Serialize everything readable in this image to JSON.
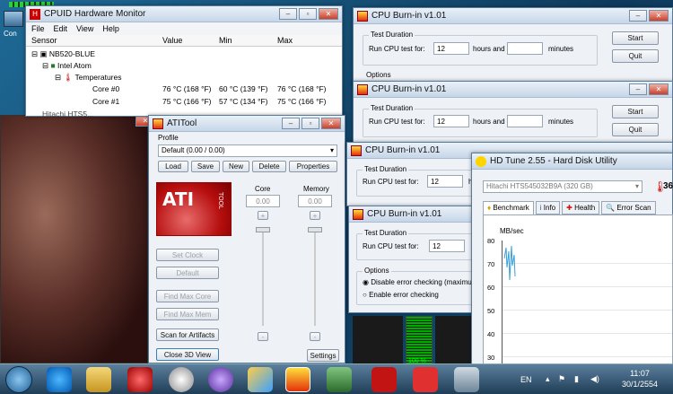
{
  "taskbar": {
    "lang": "EN",
    "time": "11:07",
    "date": "30/1/2554"
  },
  "desktop": {
    "icon_label": "Con"
  },
  "cpuid": {
    "title": "CPUID Hardware Monitor",
    "menu": [
      "File",
      "Edit",
      "View",
      "Help"
    ],
    "headers": [
      "Sensor",
      "Value",
      "Min",
      "Max"
    ],
    "tree": {
      "computer": "NB520-BLUE",
      "cpu": "Intel Atom",
      "group": "Temperatures",
      "partial": "Hitachi HTS5..."
    },
    "rows": [
      {
        "name": "Core #0",
        "value": "76 °C (168 °F)",
        "min": "60 °C (139 °F)",
        "max": "76 °C (168 °F)"
      },
      {
        "name": "Core #1",
        "value": "75 °C (166 °F)",
        "min": "57 °C (134 °F)",
        "max": "75 °C (166 °F)"
      }
    ]
  },
  "atitool": {
    "title": "ATITool",
    "profile_label": "Profile",
    "profile_value": "Default (0.00 / 0.00)",
    "buttons": {
      "load": "Load",
      "save": "Save",
      "new": "New",
      "delete": "Delete",
      "properties": "Properties"
    },
    "logo_text": "ATI",
    "logo_sub": "TOOL",
    "core_label": "Core",
    "memory_label": "Memory",
    "core_value": "0.00",
    "memory_value": "0.00",
    "plus": "+",
    "minus": "-",
    "actions": {
      "set_clock": "Set Clock",
      "default": "Default",
      "max_core": "Find Max Core",
      "max_mem": "Find Max Mem",
      "scan": "Scan for Artifacts",
      "close3d": "Close 3D View",
      "settings": "Settings"
    }
  },
  "burnin": {
    "title": "CPU Burn-in v1.01",
    "test_duration": "Test Duration",
    "run_label": "Run CPU test for:",
    "hours_value": "12",
    "hours_label": "hours and",
    "minutes_label": "minutes",
    "start": "Start",
    "quit": "Quit",
    "options": "Options",
    "opt1": "Disable error checking (maximum",
    "opt2": "Enable error checking",
    "partial_h": "h"
  },
  "hdtune": {
    "title": "HD Tune 2.55 - Hard Disk Utility",
    "drive": "Hitachi HTS545032B9A (320 GB)",
    "temp": "36",
    "tabs": [
      "Benchmark",
      "Info",
      "Health",
      "Error Scan"
    ],
    "unit": "MB/sec",
    "yticks": [
      "80",
      "70",
      "60",
      "50",
      "40",
      "30",
      "20"
    ]
  },
  "progress": "100 %"
}
